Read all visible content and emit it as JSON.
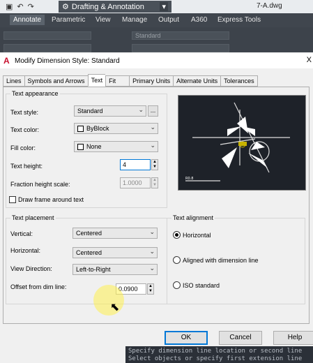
{
  "app": {
    "workspace": "Drafting & Annotation",
    "file_name": "7-A.dwg",
    "ribbon_tabs": [
      "Annotate",
      "Parametric",
      "View",
      "Manage",
      "Output",
      "A360",
      "Express Tools"
    ],
    "ribbon_style_value": "Standard"
  },
  "dialog": {
    "title": "Modify Dimension Style: Standard",
    "close": "X",
    "tabs": [
      "Lines",
      "Symbols and Arrows",
      "Text",
      "Fit",
      "Primary Units",
      "Alternate Units",
      "Tolerances"
    ],
    "active_tab": "Text",
    "text_appearance": {
      "heading": "Text appearance",
      "text_style_label": "Text style:",
      "text_style_value": "Standard",
      "text_style_button": "...",
      "text_color_label": "Text color:",
      "text_color_value": "ByBlock",
      "fill_color_label": "Fill color:",
      "fill_color_value": "None",
      "text_height_label": "Text height:",
      "text_height_value": "4",
      "fraction_label": "Fraction height scale:",
      "fraction_value": "1.0000",
      "draw_frame_label": "Draw frame around text"
    },
    "text_placement": {
      "heading": "Text placement",
      "vertical_label": "Vertical:",
      "vertical_value": "Centered",
      "horizontal_label": "Horizontal:",
      "horizontal_value": "Centered",
      "view_direction_label": "View Direction:",
      "view_direction_value": "Left-to-Right",
      "offset_label": "Offset from dim line:",
      "offset_value": "0.0900"
    },
    "text_alignment": {
      "heading": "Text alignment",
      "options": [
        "Horizontal",
        "Aligned with dimension line",
        "ISO standard"
      ],
      "selected": "Horizontal"
    },
    "buttons": {
      "ok": "OK",
      "cancel": "Cancel",
      "help": "Help"
    }
  },
  "command_line": [
    "Specify dimension line location or second line",
    "Select objects or specify first extension line"
  ],
  "colors": {
    "accent": "#0078d7",
    "ribbon": "#40464e",
    "preview_bg": "#1e2229"
  }
}
